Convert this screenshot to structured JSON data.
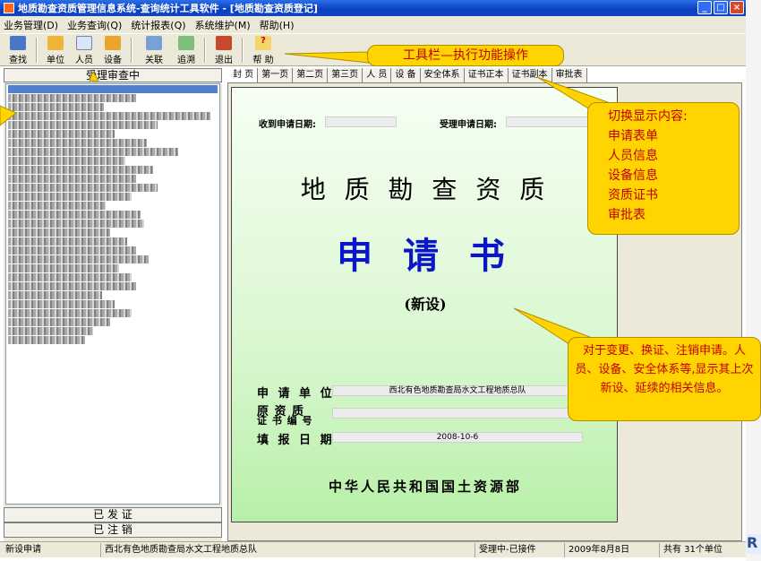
{
  "window": {
    "title": "地质勘查资质管理信息系统-查询统计工具软件 - [地质勘查资质登记]"
  },
  "menu": [
    "业务管理(D)",
    "业务查询(Q)",
    "统计报表(Q)",
    "系统维护(M)",
    "帮助(H)"
  ],
  "toolbar": {
    "find": "查找",
    "unit": "单位",
    "person": "人员",
    "equip": "设备",
    "relate": "关联",
    "trace": "追溯",
    "exit": "退出",
    "help": "帮 助"
  },
  "left_panel": {
    "header": "受理审查中",
    "footer1": "已 发 证",
    "footer2": "已 注 销"
  },
  "tabs": [
    "封 页",
    "第一页",
    "第二页",
    "第三页",
    "人 员",
    "设 备",
    "安全体系",
    "证书正本",
    "证书副本",
    "审批表"
  ],
  "doc": {
    "recv_date_label": "收到申请日期:",
    "accept_date_label": "受理申请日期:",
    "title1": "地 质 勘 查 资 质",
    "title2": "申 请 书",
    "subtitle": "(新设)",
    "applicant_label": "申 请 单 位",
    "applicant_value": "西北有色地质勘查局水文工程地质总队",
    "orig_label1": "原 资 质",
    "orig_label2": "证 书 编 号",
    "fill_date_label": "填 报 日 期",
    "fill_date_value": "2008-10-6",
    "ministry": "中华人民共和国国土资源部"
  },
  "status": [
    "新设申请",
    "西北有色地质勘查局水文工程地质总队",
    "受理中-已接件",
    "2009年8月8日",
    "共有 31个单位"
  ],
  "callouts": {
    "toolbar": "工具栏—执行功能操作",
    "switch": [
      "切换显示内容:",
      "申请表单",
      "人员信息",
      "设备信息",
      "资质证书",
      "审批表"
    ],
    "note": "对于变更、换证、注销申请。人员、设备、安全体系等,显示其上次新设、延续的相关信息。"
  },
  "logo_letter": "R"
}
